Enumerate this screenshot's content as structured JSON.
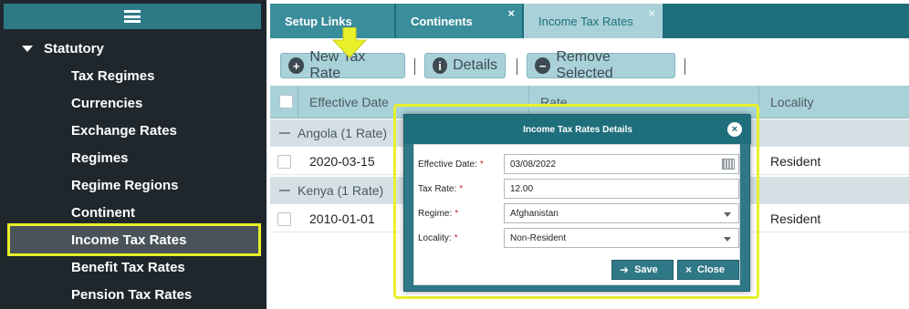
{
  "sidebar": {
    "section_label": "Statutory",
    "items": [
      {
        "label": "Tax Regimes"
      },
      {
        "label": "Currencies"
      },
      {
        "label": "Exchange Rates"
      },
      {
        "label": "Regimes"
      },
      {
        "label": "Regime Regions"
      },
      {
        "label": "Continent"
      },
      {
        "label": "Income Tax Rates"
      },
      {
        "label": "Benefit Tax Rates"
      },
      {
        "label": "Pension Tax Rates"
      }
    ],
    "active_item": "Income Tax Rates"
  },
  "tabs": [
    {
      "label": "Setup Links",
      "closable": false
    },
    {
      "label": "Continents",
      "closable": true,
      "close_glyph": "×"
    },
    {
      "label": "Income Tax Rates",
      "closable": true,
      "close_glyph": "×",
      "active": true
    }
  ],
  "toolbar": {
    "new_label": "New Tax Rate",
    "details_label": "Details",
    "remove_label": "Remove Selected",
    "new_icon": "plus-icon",
    "details_icon": "info-icon",
    "remove_icon": "minus-icon"
  },
  "grid": {
    "columns": [
      "Effective Date",
      "Rate",
      "Locality"
    ],
    "groups": [
      {
        "label": "Angola (1 Rate)",
        "rows": [
          {
            "effective_date": "2020-03-15",
            "locality": "Resident"
          }
        ]
      },
      {
        "label": "Kenya (1 Rate)",
        "rows": [
          {
            "effective_date": "2010-01-01",
            "locality": "Resident"
          }
        ]
      }
    ]
  },
  "modal": {
    "title": "Income Tax Rates Details",
    "fields": [
      {
        "label": "Effective Date:",
        "value": "03/08/2022",
        "required": "*"
      },
      {
        "label": "Tax Rate:",
        "value": "12.00",
        "required": "*"
      },
      {
        "label": "Regime:",
        "value": "Afghanistan",
        "required": "*"
      },
      {
        "label": "Locality:",
        "value": "Non-Resident",
        "required": "*"
      }
    ],
    "save_label": "Save",
    "close_label": "Close",
    "close_glyph": "×"
  },
  "colors": {
    "sidebar_bg": "#1f272d",
    "teal": "#1f6e7c",
    "light_teal": "#a9d2d8",
    "highlight": "#e8f02a",
    "required": "#c4242b"
  }
}
